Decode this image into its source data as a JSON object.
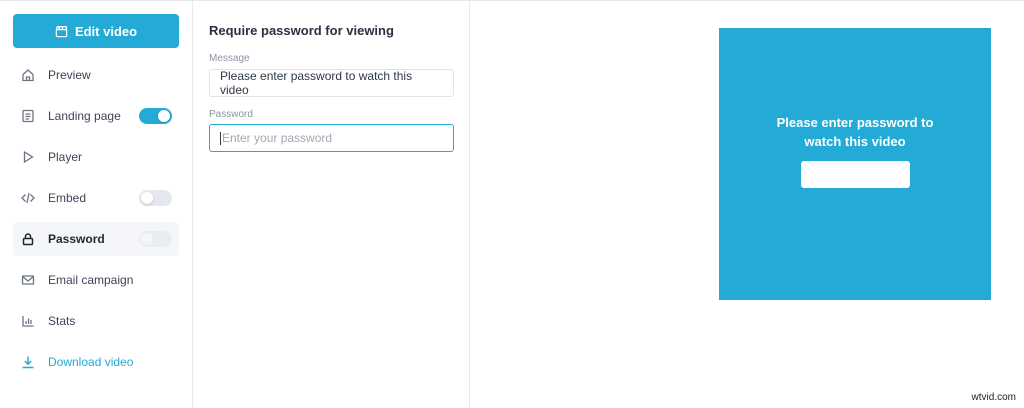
{
  "sidebar": {
    "edit_button": "Edit video",
    "items": [
      {
        "label": "Preview",
        "icon": "home-icon"
      },
      {
        "label": "Landing page",
        "icon": "document-icon",
        "toggle": "on"
      },
      {
        "label": "Player",
        "icon": "play-icon"
      },
      {
        "label": "Embed",
        "icon": "code-icon",
        "toggle": "off"
      },
      {
        "label": "Password",
        "icon": "lock-icon",
        "toggle": "disabled",
        "active": true
      },
      {
        "label": "Email campaign",
        "icon": "mail-icon"
      },
      {
        "label": "Stats",
        "icon": "chart-icon"
      },
      {
        "label": "Download video",
        "icon": "download-icon"
      }
    ]
  },
  "form": {
    "title": "Require password for viewing",
    "message_label": "Message",
    "message_value": "Please enter password to watch this video",
    "password_label": "Password",
    "password_placeholder": "Enter your password"
  },
  "preview": {
    "message": "Please enter password to watch this video"
  },
  "watermark": "wtvid.com",
  "colors": {
    "accent": "#23aad6"
  }
}
